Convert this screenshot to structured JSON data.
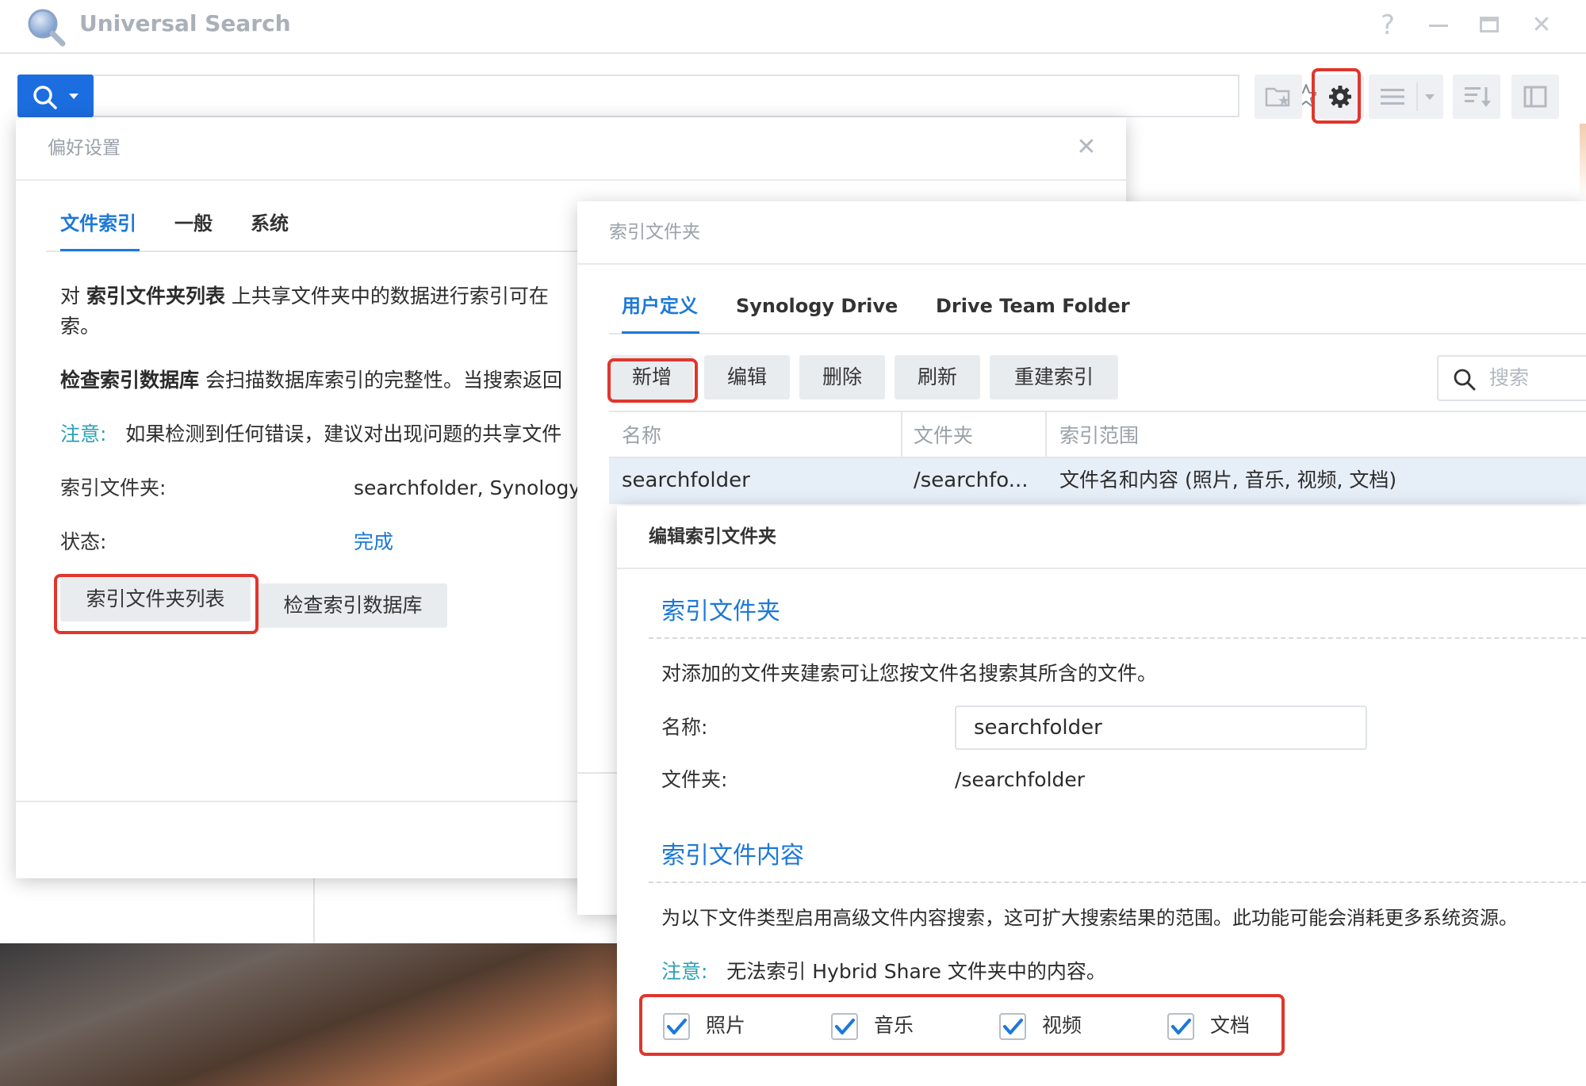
{
  "window": {
    "title": "Universal Search",
    "help": "?",
    "minimize": "—",
    "close": "✕"
  },
  "toolbar": {
    "search_placeholder": ""
  },
  "prefs": {
    "title": "偏好设置",
    "tabs": [
      "文件索引",
      "一般",
      "系统"
    ],
    "desc1_pre": "对 ",
    "desc1_bold": "索引文件夹列表",
    "desc1_post": " 上共享文件夹中的数据进行索引可在",
    "desc1_line2": "索。",
    "desc2_bold": "检查索引数据库",
    "desc2_post": " 会扫描数据库索引的完整性。当搜索返回",
    "note_label": "注意:",
    "note_text": "如果检测到任何错误，建议对出现问题的共享文件",
    "index_folder_label": "索引文件夹:",
    "index_folder_value": "searchfolder, Synology",
    "status_label": "状态:",
    "status_value": "完成",
    "btn_list": "索引文件夹列表",
    "btn_check": "检查索引数据库"
  },
  "index_folders": {
    "title": "索引文件夹",
    "tabs": [
      "用户定义",
      "Synology Drive",
      "Drive Team Folder"
    ],
    "buttons": [
      "新增",
      "编辑",
      "删除",
      "刷新",
      "重建索引"
    ],
    "search_placeholder": "搜索",
    "columns": [
      "名称",
      "文件夹",
      "索引范围"
    ],
    "rows": [
      {
        "name": "searchfolder",
        "folder": "/searchfo...",
        "scope": "文件名和内容 (照片, 音乐, 视频, 文档)"
      }
    ]
  },
  "edit": {
    "title": "编辑索引文件夹",
    "section1": "索引文件夹",
    "section1_desc": "对添加的文件夹建索可让您按文件名搜索其所含的文件。",
    "name_label": "名称:",
    "name_value": "searchfolder",
    "folder_label": "文件夹:",
    "folder_value": "/searchfolder",
    "section2": "索引文件内容",
    "section2_desc": "为以下文件类型启用高级文件内容搜索，这可扩大搜索结果的范围。此功能可能会消耗更多系统资源。",
    "note_label": "注意:",
    "note_text": "无法索引 Hybrid Share 文件夹中的内容。",
    "checkboxes": [
      {
        "label": "照片",
        "checked": true
      },
      {
        "label": "音乐",
        "checked": true
      },
      {
        "label": "视频",
        "checked": true
      },
      {
        "label": "文档",
        "checked": true
      }
    ]
  },
  "colors": {
    "accent": "#1d78d8",
    "highlight": "#e0362c",
    "note": "#2a9fb5"
  }
}
